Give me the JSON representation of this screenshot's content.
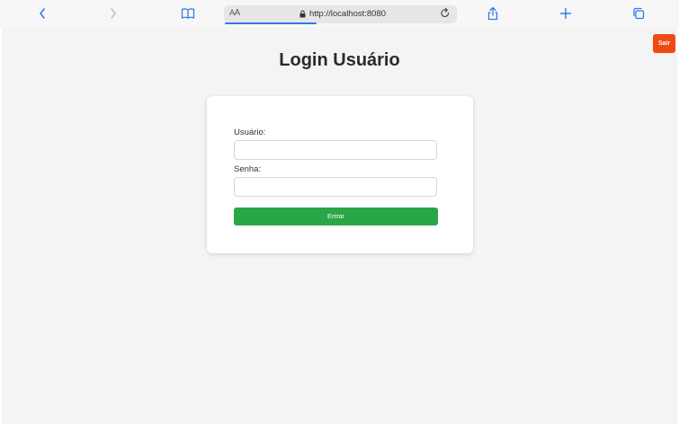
{
  "browser": {
    "text_size_label_small": "A",
    "text_size_label_big": "A",
    "url": "http://localhost:8080",
    "icons": [
      "back-icon",
      "forward-icon",
      "bookmarks-icon",
      "lock-icon",
      "reload-icon",
      "share-icon",
      "new-tab-icon",
      "tabs-icon"
    ],
    "accent_color": "#2f7ae5"
  },
  "header": {
    "logout_label": "Sair",
    "logout_color": "#f04a14"
  },
  "login": {
    "title": "Login Usuário",
    "username_label": "Usuário:",
    "username_value": "",
    "password_label": "Senha:",
    "password_value": "",
    "submit_label": "Entrar",
    "submit_color": "#29a645"
  }
}
